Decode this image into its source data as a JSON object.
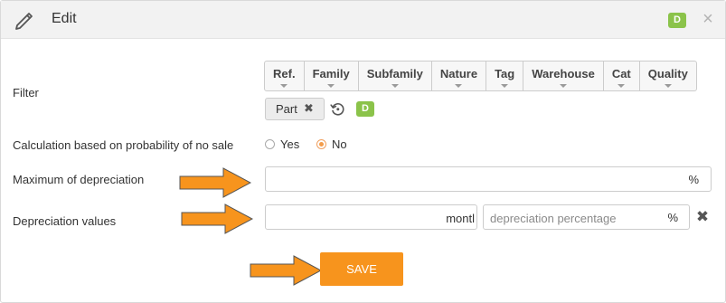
{
  "header": {
    "title": "Edit",
    "badge": "D",
    "close_symbol": "×"
  },
  "filter": {
    "label": "Filter",
    "columns": [
      "Ref.",
      "Family",
      "Subfamily",
      "Nature",
      "Tag",
      "Warehouse",
      "Cat",
      "Quality"
    ],
    "chip": {
      "label": "Part",
      "remove_symbol": "✖"
    },
    "badge": "D"
  },
  "calculation": {
    "label": "Calculation based on probability of no sale",
    "options": [
      {
        "label": "Yes",
        "checked": false
      },
      {
        "label": "No",
        "checked": true
      }
    ]
  },
  "max_depreciation": {
    "label": "Maximum of depreciation",
    "value": "",
    "suffix": "%"
  },
  "depreciation_values": {
    "label": "Depreciation values",
    "months_value": "montl",
    "percentage_placeholder": "depreciation percentage",
    "percentage_suffix": "%",
    "remove_symbol": "✖"
  },
  "save_label": "SAVE",
  "colors": {
    "accent": "#f7941d",
    "badge_green": "#8bc34a",
    "annotation_arrow": "#f7941d"
  }
}
